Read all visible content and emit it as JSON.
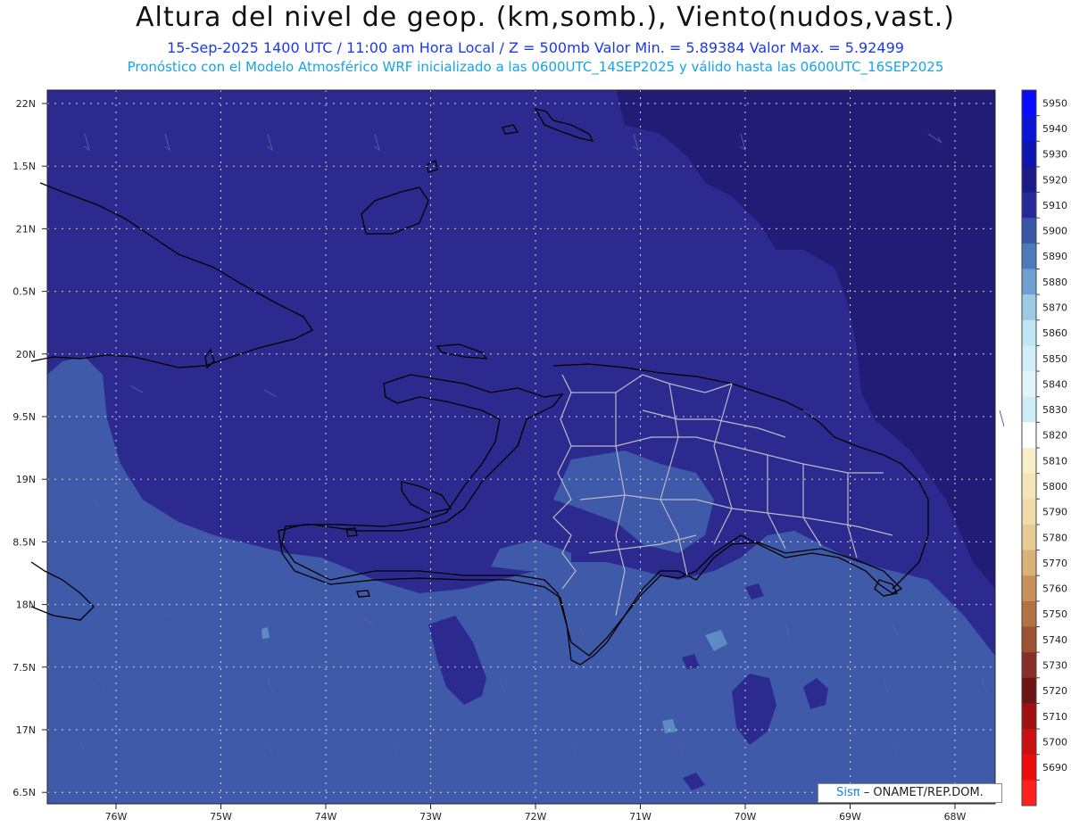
{
  "header": {
    "title": "Altura del nivel de geop. (km,somb.), Viento(nudos,vast.)",
    "subtitle": "15-Sep-2025  1400 UTC / 11:00 am Hora Local / Z = 500mb    Valor Min. = 5.89384   Valor Max. = 5.92499",
    "subtitle2": "Pronóstico con el Modelo Atmosférico WRF inicializado a las 0600UTC_14SEP2025 y válido hasta las  0600UTC_16SEP2025"
  },
  "axes": {
    "lat_labels": [
      "22N",
      "1.5N",
      "21N",
      "0.5N",
      "20N",
      "9.5N",
      "19N",
      "8.5N",
      "18N",
      "7.5N",
      "17N",
      "6.5N"
    ],
    "lon_labels": [
      "76W",
      "75W",
      "74W",
      "73W",
      "72W",
      "71W",
      "70W",
      "69W",
      "68W"
    ]
  },
  "colorbar": {
    "levels": [
      "5950",
      "5940",
      "5930",
      "5920",
      "5910",
      "5900",
      "5890",
      "5880",
      "5870",
      "5860",
      "5850",
      "5840",
      "5830",
      "5820",
      "5810",
      "5800",
      "5790",
      "5780",
      "5770",
      "5760",
      "5750",
      "5740",
      "5730",
      "5720",
      "5710",
      "5700",
      "5690"
    ],
    "colors": [
      "#0a0aff",
      "#0a14d8",
      "#0f16b0",
      "#1c1a88",
      "#29289a",
      "#3a55a8",
      "#4b7bbb",
      "#6ea1cf",
      "#9cc9e3",
      "#bfe6f2",
      "#d2eef7",
      "#e2f4fa",
      "#cdeef6",
      "#ffffff",
      "#f8efc9",
      "#f4e6ba",
      "#efdcaa",
      "#e6cb95",
      "#d9b27a",
      "#c98f5d",
      "#b37244",
      "#9c5233",
      "#872e2a",
      "#6e1414",
      "#a01010",
      "#c81010",
      "#ee0d0d",
      "#ff2020"
    ]
  },
  "map_colors": {
    "level_5910": "#2d2a8f",
    "level_5920": "#221c76",
    "level_5900": "#3e5aa8",
    "level_5890": "#5f8ac4"
  },
  "credit": {
    "logo": "Sisπ",
    "text": "– ONAMET/REP.DOM."
  }
}
